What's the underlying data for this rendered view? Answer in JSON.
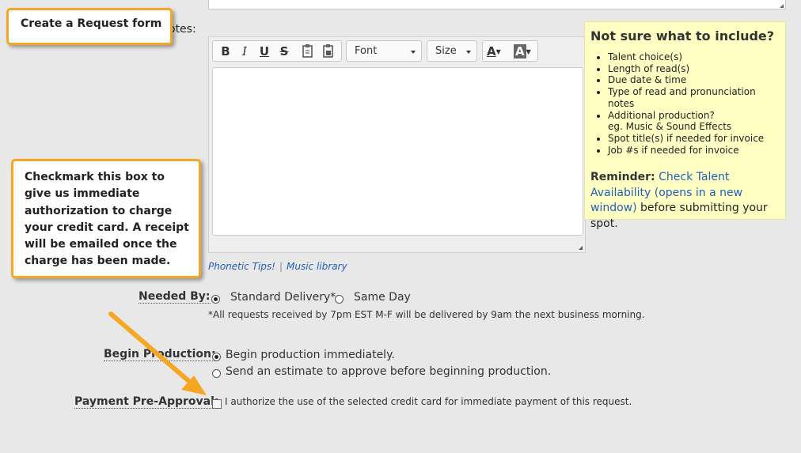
{
  "notes_label_tail": "otes:",
  "toolbar": {
    "bold": "B",
    "italic": "I",
    "underline": "U",
    "strike": "S",
    "font_label": "Font",
    "size_label": "Size",
    "text_color": "A",
    "bg_color": "A"
  },
  "tips": {
    "title": "Not sure what to include?",
    "items": [
      "Talent choice(s)",
      "Length of read(s)",
      "Due date & time",
      "Type of read and pronunciation notes",
      "Additional production?",
      "Spot title(s) if needed for invoice",
      "Job #s if needed for invoice"
    ],
    "additional_sub": "eg. Music & Sound Effects",
    "reminder_label": "Reminder:",
    "reminder_link": "Check Talent Availability (opens in a new window)",
    "reminder_tail": " before submitting your spot."
  },
  "links": {
    "phonetic": "Phonetic Tips!",
    "separator": "|",
    "music": "Music library"
  },
  "needed_by": {
    "label": "Needed By:",
    "options": [
      "Standard Delivery*",
      "Same Day"
    ],
    "selected": "Standard Delivery*",
    "note": "*All requests received by 7pm EST M-F will be delivered by 9am the next business morning."
  },
  "begin_production": {
    "label": "Begin Production:",
    "options": [
      "Begin production immediately.",
      "Send an estimate to approve before beginning production."
    ],
    "selected": "Begin production immediately."
  },
  "payment": {
    "label": "Payment Pre-Approval:",
    "checkbox_text": "I authorize the use of the selected credit card for immediate payment of this request.",
    "checked": false
  },
  "annotations": {
    "callout1": "Create a Request form",
    "callout2": "Checkmark this box to give us immediate authorization to charge your credit card. A receipt will be emailed once the charge has been made."
  },
  "colors": {
    "accent_orange": "#f5a623",
    "tips_bg": "#ffffc4",
    "link": "#2160b8"
  }
}
